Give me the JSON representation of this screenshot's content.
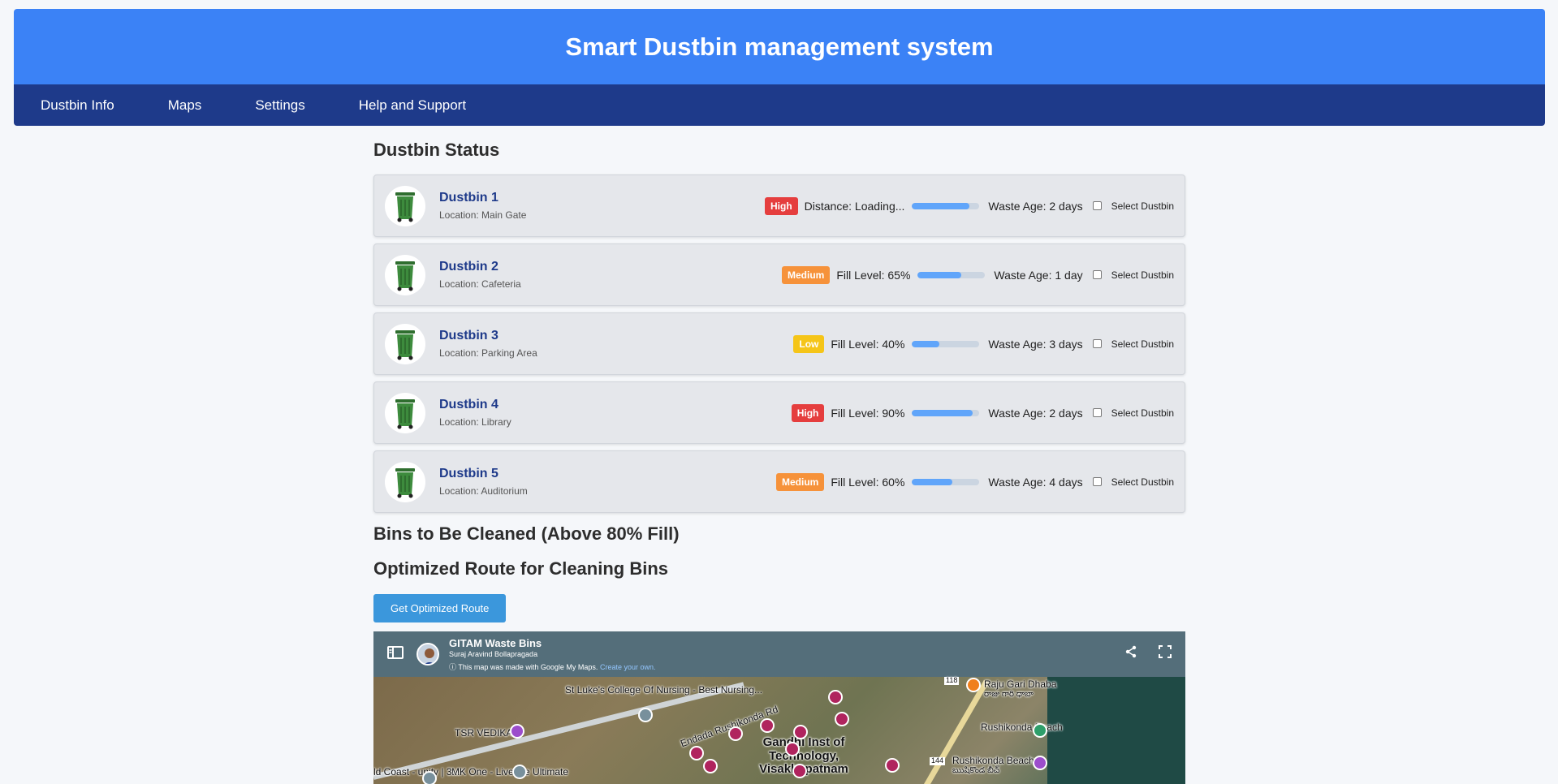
{
  "header": {
    "title": "Smart Dustbin management system"
  },
  "nav": {
    "items": [
      "Dustbin Info",
      "Maps",
      "Settings",
      "Help and Support"
    ]
  },
  "status": {
    "title": "Dustbin Status",
    "bins": [
      {
        "name": "Dustbin 1",
        "location": "Location: Main Gate",
        "priority": "High",
        "metric_text": "Distance: Loading...",
        "fill": 0.85,
        "waste_age": "Waste Age: 2 days",
        "select_label": "Select Dustbin"
      },
      {
        "name": "Dustbin 2",
        "location": "Location: Cafeteria",
        "priority": "Medium",
        "metric_text": "Fill Level: 65%",
        "fill": 0.65,
        "waste_age": "Waste Age: 1 day",
        "select_label": "Select Dustbin"
      },
      {
        "name": "Dustbin 3",
        "location": "Location: Parking Area",
        "priority": "Low",
        "metric_text": "Fill Level: 40%",
        "fill": 0.4,
        "waste_age": "Waste Age: 3 days",
        "select_label": "Select Dustbin"
      },
      {
        "name": "Dustbin 4",
        "location": "Location: Library",
        "priority": "High",
        "metric_text": "Fill Level: 90%",
        "fill": 0.9,
        "waste_age": "Waste Age: 2 days",
        "select_label": "Select Dustbin"
      },
      {
        "name": "Dustbin 5",
        "location": "Location: Auditorium",
        "priority": "Medium",
        "metric_text": "Fill Level: 60%",
        "fill": 0.6,
        "waste_age": "Waste Age: 4 days",
        "select_label": "Select Dustbin"
      }
    ]
  },
  "clean": {
    "title": "Bins to Be Cleaned (Above 80% Fill)"
  },
  "route": {
    "title": "Optimized Route for Cleaning Bins",
    "button": "Get Optimized Route"
  },
  "map": {
    "title": "GITAM Waste Bins",
    "author": "Suraj Aravind Bollapragada",
    "note": "This map was made with Google My Maps.",
    "note_link": "Create your own.",
    "labels": {
      "nursing": "St Luke's College Of Nursing - Best Nursing...",
      "tsr": "TSR VEDIKA",
      "road": "Endada Rushikonda Rd",
      "gandhi": "Gandhi Inst of Technology, Visakhapatnam",
      "raju": "Raju Gari Dhaba",
      "raju_te": "రాజు గారి ధాబా",
      "rushikonda_beach_park": "Rushikonda Beach",
      "rushikonda_beach": "Rushikonda Beach",
      "rushikonda_beach_te": "ఋషికొండ బీచ్",
      "mk_one": "MK One - Live the Ultimate",
      "gold_coast": "ld Coast - unity | 3...",
      "route_118": "118",
      "route_144": "144"
    }
  },
  "colors": {
    "header": "#3b82f6",
    "nav": "#1e3a8a",
    "high": "#e53e3e",
    "medium": "#f6923a",
    "low": "#f5c518",
    "progress": "#60a5fa",
    "button": "#3b97dc"
  }
}
